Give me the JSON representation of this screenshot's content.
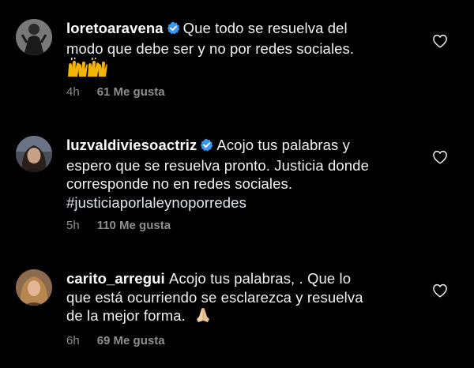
{
  "comments": [
    {
      "username": "loretoaravena",
      "verified": true,
      "lines": [
        "Que todo se resuelva del",
        "modo que debe ser y no por redes sociales."
      ],
      "emoji": "raising-hands",
      "time": "4h",
      "likes": "61 Me gusta"
    },
    {
      "username": "luzvaldiviesoactriz",
      "verified": true,
      "lines": [
        "Acojo tus palabras y",
        "espero que se resuelva pronto. Justicia donde",
        "corresponde no en redes sociales."
      ],
      "hashtag": "#justiciaporlaleynoporredes",
      "time": "5h",
      "likes": "110 Me gusta"
    },
    {
      "username": "carito_arregui",
      "verified": false,
      "lines": [
        "Acojo tus palabras, . Que lo",
        "que está ocurriendo se esclarezca y resuelva",
        "de la mejor forma."
      ],
      "emoji": "folded-hands",
      "time": "6h",
      "likes": "69 Me gusta"
    }
  ],
  "icons": {
    "like": "heart-outline-icon",
    "verified": "verified-badge-icon"
  },
  "colors": {
    "background": "#000000",
    "text": "#f2f2f2",
    "meta": "#8e8e8e",
    "verified": "#3897f0"
  }
}
